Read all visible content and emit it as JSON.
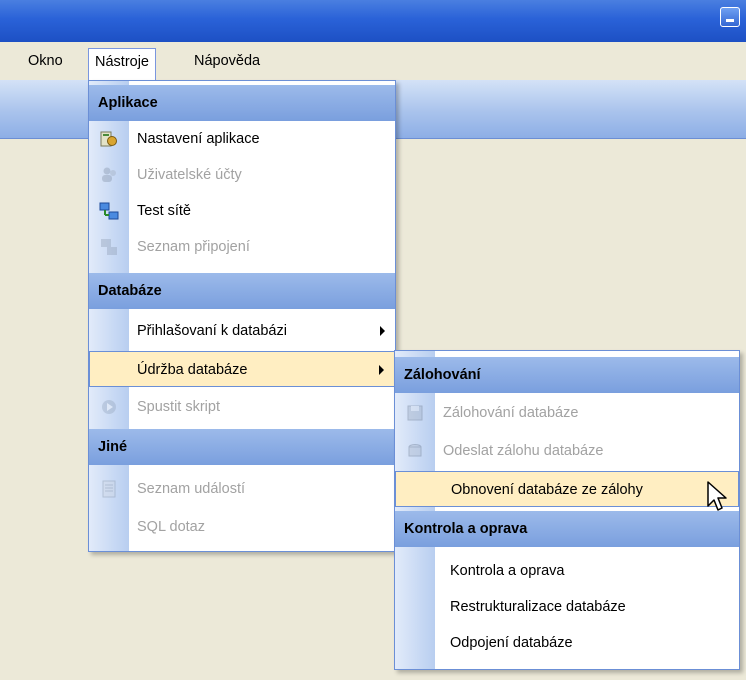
{
  "menubar": {
    "items": [
      {
        "label": "Okno"
      },
      {
        "label": "Nástroje"
      },
      {
        "label": "Nápověda"
      }
    ]
  },
  "tools_menu": {
    "sections": [
      {
        "header": "Aplikace"
      },
      {
        "header": "Databáze"
      },
      {
        "header": "Jiné"
      }
    ],
    "items": [
      {
        "label": "Nastavení aplikace",
        "enabled": true,
        "icon": "settings-icon"
      },
      {
        "label": "Uživatelské účty",
        "enabled": false,
        "icon": "users-icon"
      },
      {
        "label": "Test sítě",
        "enabled": true,
        "icon": "network-test-icon"
      },
      {
        "label": "Seznam připojení",
        "enabled": false,
        "icon": "connections-icon"
      },
      {
        "label": "Přihlašovaní k databázi",
        "enabled": true,
        "submenu": true
      },
      {
        "label": "Údržba databáze",
        "enabled": true,
        "submenu": true,
        "highlighted": true
      },
      {
        "label": "Spustit skript",
        "enabled": false,
        "icon": "run-script-icon"
      },
      {
        "label": "Seznam událostí",
        "enabled": false,
        "icon": "event-list-icon"
      },
      {
        "label": "SQL dotaz",
        "enabled": false
      }
    ]
  },
  "maintenance_submenu": {
    "sections": [
      {
        "header": "Zálohování"
      },
      {
        "header": "Kontrola a oprava"
      }
    ],
    "items": [
      {
        "label": "Zálohování databáze",
        "enabled": false,
        "icon": "backup-icon"
      },
      {
        "label": "Odeslat zálohu databáze",
        "enabled": false,
        "icon": "send-backup-icon"
      },
      {
        "label": "Obnovení databáze ze zálohy",
        "enabled": true,
        "highlighted": true
      },
      {
        "label": "Kontrola a oprava",
        "enabled": true
      },
      {
        "label": "Restrukturalizace databáze",
        "enabled": true
      },
      {
        "label": "Odpojení databáze",
        "enabled": true
      }
    ]
  },
  "colors": {
    "menu_header": "#8eaee6",
    "highlight": "#ffeec2",
    "border": "#6b8fd6",
    "disabled_text": "#a2a2a2"
  }
}
